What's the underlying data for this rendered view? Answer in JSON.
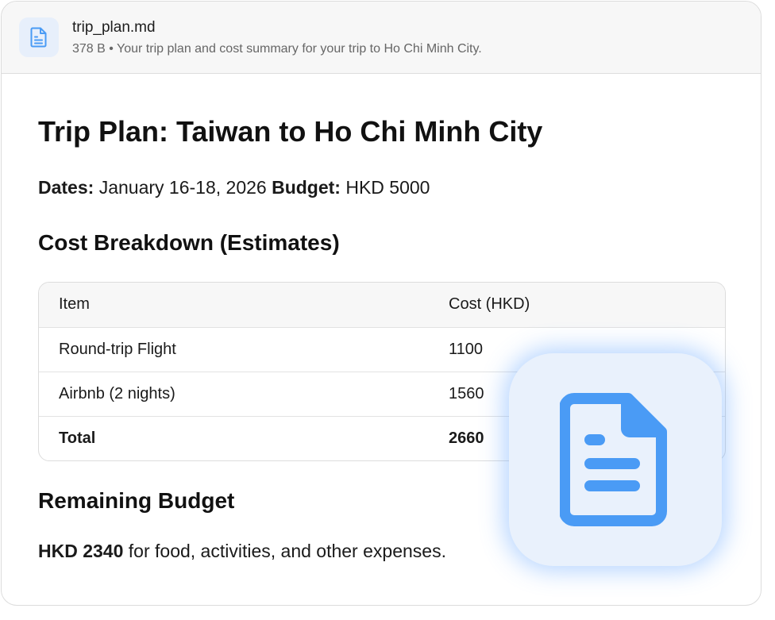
{
  "file": {
    "name": "trip_plan.md",
    "meta": "378 B • Your trip plan and cost summary for your trip to Ho Chi Minh City.",
    "icon": "document-icon"
  },
  "doc": {
    "title": "Trip Plan: Taiwan to Ho Chi Minh City",
    "dates_label": "Dates:",
    "dates_value": "January 16-18, 2026",
    "budget_label": "Budget:",
    "budget_value": "HKD 5000",
    "cost_heading": "Cost Breakdown (Estimates)",
    "table": {
      "headers": [
        "Item",
        "Cost (HKD)"
      ],
      "rows": [
        [
          "Round-trip Flight",
          "1100"
        ],
        [
          "Airbnb (2 nights)",
          "1560"
        ],
        [
          "Total",
          "2660"
        ]
      ]
    },
    "remaining_heading": "Remaining Budget",
    "remaining_amount": "HKD 2340",
    "remaining_text": "for food, activities, and other expenses."
  },
  "colors": {
    "accent": "#4a9bf5",
    "icon_bg": "#e9f1fc"
  },
  "overlay_icon": "document-icon"
}
